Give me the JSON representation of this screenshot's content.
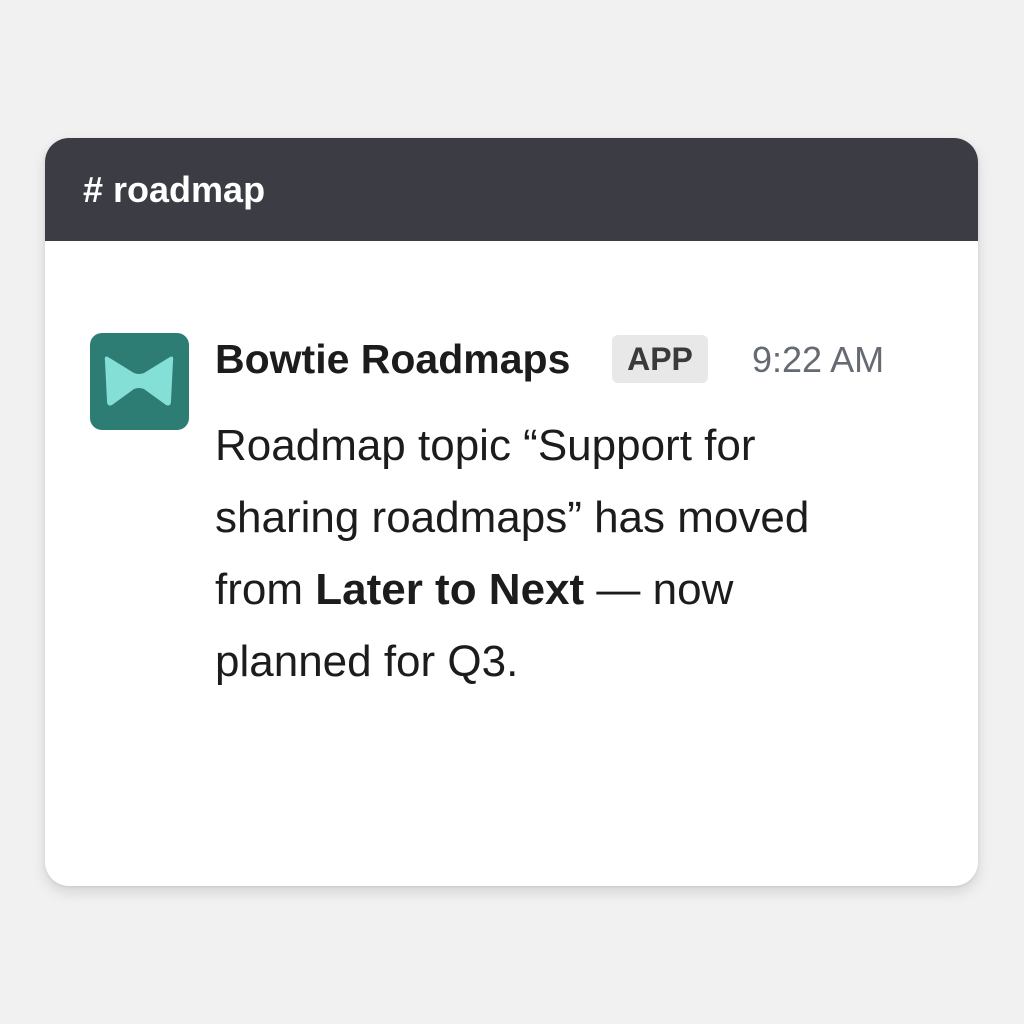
{
  "channel": {
    "name": "# roadmap",
    "header_color": "#3b3c44"
  },
  "message": {
    "avatar_icon": "bowtie-icon",
    "avatar_bg_color": "#2e7d75",
    "avatar_icon_color": "#84e0d6",
    "sender": "Bowtie Roadmaps",
    "badge": "APP",
    "timestamp": "9:22 AM",
    "text_part1": "Roadmap topic “Support for sharing roadmaps” has moved from ",
    "text_bold": "Later to Next",
    "text_part2": " — now planned for Q3."
  }
}
